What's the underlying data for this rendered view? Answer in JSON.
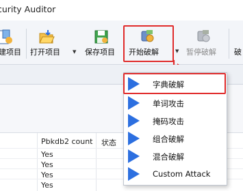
{
  "window": {
    "title": "curity Auditor"
  },
  "toolbar": {
    "new_label": "建项目",
    "open_label": "打开项目",
    "save_label": "保存项目",
    "start_label": "开始破解",
    "pause_label": "暂停破解",
    "more_label": "破"
  },
  "table": {
    "headers": [
      "Pbkdb2 count",
      "状态"
    ],
    "rows": [
      "Yes",
      "Yes",
      "Yes",
      "Yes"
    ]
  },
  "menu": {
    "items": [
      {
        "label": "字典破解"
      },
      {
        "label": "单词攻击"
      },
      {
        "label": "掩码攻击"
      },
      {
        "label": "组合破解"
      },
      {
        "label": "混合破解"
      },
      {
        "label": "Custom Attack"
      }
    ]
  },
  "colors": {
    "accent": "#2c6fe0",
    "highlight": "#e02a2a"
  }
}
